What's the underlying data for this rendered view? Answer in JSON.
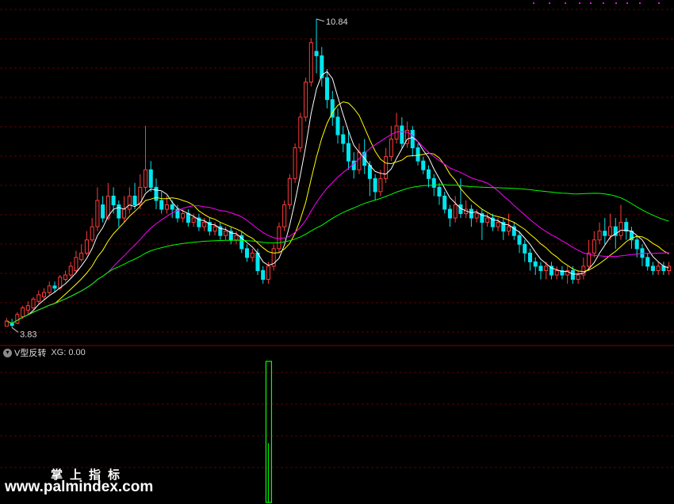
{
  "indicator": {
    "name": "V型反转",
    "xg_label": "XG:",
    "xg_value": "0.00"
  },
  "watermark": {
    "cn": "掌上指标",
    "url": "www.palmindex.com"
  },
  "colors": {
    "background": "#000000",
    "grid": "#5a0000",
    "separator": "#8b0000",
    "up": "#ff3b3b",
    "down": "#00e5ee",
    "ma5": "#ffffff",
    "ma10": "#ffff00",
    "ma20": "#ff00ff",
    "ma60": "#00ff00",
    "signal": "#00ff00",
    "marker": "#ff00ff"
  },
  "chart_data": [
    {
      "type": "candlestick",
      "panel": "main",
      "ylim": [
        3.5,
        11.2
      ],
      "annotations": {
        "high": "10.84",
        "low": "3.83"
      },
      "candles": [
        [
          3.83,
          3.95,
          3.9,
          4.02
        ],
        [
          3.9,
          3.85,
          3.8,
          4.0
        ],
        [
          3.9,
          4.1,
          3.88,
          4.15
        ],
        [
          4.05,
          4.25,
          4.0,
          4.3
        ],
        [
          4.2,
          4.3,
          4.1,
          4.4
        ],
        [
          4.25,
          4.45,
          4.2,
          4.5
        ],
        [
          4.4,
          4.55,
          4.35,
          4.65
        ],
        [
          4.5,
          4.6,
          4.45,
          4.7
        ],
        [
          4.6,
          4.75,
          4.55,
          4.85
        ],
        [
          4.75,
          4.7,
          4.6,
          4.85
        ],
        [
          4.7,
          4.95,
          4.65,
          5.0
        ],
        [
          4.9,
          5.0,
          4.85,
          5.1
        ],
        [
          5.0,
          5.2,
          4.95,
          5.3
        ],
        [
          5.1,
          5.4,
          5.05,
          5.55
        ],
        [
          5.35,
          5.5,
          5.3,
          5.7
        ],
        [
          5.5,
          5.8,
          5.45,
          6.0
        ],
        [
          5.8,
          6.1,
          5.75,
          6.3
        ],
        [
          6.1,
          6.7,
          6.0,
          7.0
        ],
        [
          6.6,
          6.3,
          6.2,
          6.8
        ],
        [
          6.3,
          6.8,
          6.25,
          7.1
        ],
        [
          6.8,
          6.6,
          6.4,
          7.0
        ],
        [
          6.6,
          6.3,
          6.1,
          6.7
        ],
        [
          6.3,
          6.5,
          6.2,
          6.8
        ],
        [
          6.5,
          6.8,
          6.4,
          7.0
        ],
        [
          6.8,
          6.6,
          6.5,
          7.1
        ],
        [
          6.6,
          7.0,
          6.5,
          7.3
        ],
        [
          7.0,
          7.4,
          6.9,
          8.4
        ],
        [
          7.4,
          7.0,
          6.9,
          7.6
        ],
        [
          7.0,
          6.7,
          6.5,
          7.2
        ],
        [
          6.7,
          6.5,
          6.4,
          6.9
        ],
        [
          6.5,
          6.6,
          6.4,
          6.8
        ],
        [
          6.6,
          6.5,
          6.3,
          6.7
        ],
        [
          6.5,
          6.3,
          6.2,
          6.6
        ],
        [
          6.3,
          6.4,
          6.2,
          6.5
        ],
        [
          6.4,
          6.2,
          6.1,
          6.5
        ],
        [
          6.2,
          6.3,
          6.1,
          6.4
        ],
        [
          6.3,
          6.1,
          6.0,
          6.4
        ],
        [
          6.1,
          6.2,
          6.0,
          6.3
        ],
        [
          6.2,
          6.0,
          5.9,
          6.3
        ],
        [
          6.0,
          6.1,
          5.9,
          6.2
        ],
        [
          6.1,
          5.9,
          5.8,
          6.2
        ],
        [
          5.9,
          6.0,
          5.8,
          6.1
        ],
        [
          6.0,
          5.8,
          5.7,
          6.1
        ],
        [
          5.8,
          5.9,
          5.7,
          6.0
        ],
        [
          5.9,
          5.6,
          5.5,
          6.0
        ],
        [
          5.6,
          5.4,
          5.3,
          5.7
        ],
        [
          5.4,
          5.5,
          5.3,
          5.6
        ],
        [
          5.5,
          5.1,
          5.0,
          5.6
        ],
        [
          5.1,
          4.9,
          4.8,
          5.2
        ],
        [
          4.9,
          5.2,
          4.8,
          5.3
        ],
        [
          5.2,
          5.6,
          5.1,
          5.7
        ],
        [
          5.6,
          6.1,
          5.5,
          6.2
        ],
        [
          6.1,
          6.6,
          6.0,
          6.7
        ],
        [
          6.6,
          7.2,
          6.5,
          7.3
        ],
        [
          7.2,
          7.9,
          7.1,
          8.0
        ],
        [
          7.9,
          8.6,
          7.8,
          8.7
        ],
        [
          8.6,
          9.4,
          8.5,
          9.5
        ],
        [
          9.4,
          10.3,
          9.3,
          10.4
        ],
        [
          10.1,
          10.0,
          9.6,
          10.84
        ],
        [
          10.0,
          9.5,
          9.3,
          10.2
        ],
        [
          9.5,
          9.0,
          8.8,
          9.7
        ],
        [
          9.0,
          8.6,
          8.4,
          9.2
        ],
        [
          8.6,
          8.2,
          8.0,
          8.8
        ],
        [
          8.2,
          8.0,
          7.8,
          8.4
        ],
        [
          8.0,
          7.6,
          7.4,
          8.3
        ],
        [
          7.6,
          7.4,
          7.2,
          7.8
        ],
        [
          7.4,
          7.8,
          7.3,
          8.0
        ],
        [
          7.8,
          7.5,
          7.3,
          8.1
        ],
        [
          7.5,
          7.2,
          6.8,
          7.6
        ],
        [
          7.2,
          6.9,
          6.7,
          7.3
        ],
        [
          6.9,
          7.2,
          6.8,
          7.4
        ],
        [
          7.2,
          7.7,
          7.1,
          7.9
        ],
        [
          7.7,
          8.1,
          7.6,
          8.4
        ],
        [
          8.1,
          8.4,
          8.0,
          8.7
        ],
        [
          8.4,
          8.0,
          7.9,
          8.6
        ],
        [
          8.0,
          8.3,
          7.9,
          8.5
        ],
        [
          8.3,
          7.9,
          7.7,
          8.4
        ],
        [
          7.9,
          7.6,
          7.5,
          8.0
        ],
        [
          7.6,
          7.4,
          7.3,
          7.7
        ],
        [
          7.4,
          7.2,
          7.0,
          7.5
        ],
        [
          7.2,
          7.0,
          6.8,
          7.3
        ],
        [
          7.0,
          6.8,
          6.6,
          7.1
        ],
        [
          6.8,
          6.5,
          6.4,
          6.9
        ],
        [
          6.5,
          6.3,
          6.1,
          6.6
        ],
        [
          6.3,
          6.6,
          6.2,
          6.8
        ],
        [
          6.6,
          6.4,
          6.3,
          7.2
        ],
        [
          6.4,
          6.5,
          6.3,
          6.7
        ],
        [
          6.5,
          6.3,
          6.1,
          6.6
        ],
        [
          6.3,
          6.4,
          6.2,
          6.5
        ],
        [
          6.4,
          6.2,
          5.8,
          6.5
        ],
        [
          6.2,
          6.3,
          6.1,
          6.4
        ],
        [
          6.3,
          6.1,
          6.0,
          6.4
        ],
        [
          6.1,
          6.2,
          6.0,
          6.3
        ],
        [
          6.2,
          6.0,
          5.8,
          6.3
        ],
        [
          6.0,
          6.1,
          5.9,
          6.4
        ],
        [
          6.1,
          5.9,
          5.8,
          6.2
        ],
        [
          5.9,
          5.7,
          5.5,
          6.0
        ],
        [
          5.7,
          5.5,
          5.3,
          5.8
        ],
        [
          5.5,
          5.3,
          5.1,
          5.6
        ],
        [
          5.3,
          5.2,
          5.0,
          5.4
        ],
        [
          5.2,
          5.1,
          4.9,
          5.3
        ],
        [
          5.1,
          5.2,
          4.9,
          5.3
        ],
        [
          5.2,
          5.0,
          4.9,
          5.3
        ],
        [
          5.0,
          5.1,
          4.9,
          5.2
        ],
        [
          5.1,
          5.0,
          4.9,
          5.2
        ],
        [
          5.0,
          5.1,
          4.8,
          5.2
        ],
        [
          5.1,
          4.9,
          4.8,
          5.2
        ],
        [
          4.9,
          5.0,
          4.8,
          5.1
        ],
        [
          5.0,
          5.2,
          4.9,
          5.4
        ],
        [
          5.2,
          5.5,
          5.1,
          5.8
        ],
        [
          5.5,
          5.8,
          5.4,
          6.0
        ],
        [
          5.8,
          6.0,
          5.7,
          6.2
        ],
        [
          6.0,
          5.9,
          5.7,
          6.3
        ],
        [
          5.9,
          6.1,
          5.8,
          6.4
        ],
        [
          6.1,
          5.9,
          5.6,
          6.3
        ],
        [
          5.9,
          6.2,
          5.8,
          6.6
        ],
        [
          6.2,
          6.0,
          5.8,
          6.3
        ],
        [
          6.0,
          5.8,
          5.6,
          6.1
        ],
        [
          5.8,
          5.6,
          5.4,
          5.9
        ],
        [
          5.6,
          5.4,
          5.2,
          5.7
        ],
        [
          5.4,
          5.2,
          5.1,
          5.5
        ],
        [
          5.2,
          5.1,
          5.0,
          5.3
        ],
        [
          5.1,
          5.2,
          5.0,
          5.3
        ],
        [
          5.2,
          5.1,
          5.0,
          5.3
        ],
        [
          5.1,
          5.2,
          5.0,
          5.3
        ]
      ],
      "ma": [
        {
          "name": "MA5",
          "period": 5,
          "color": "#ffffff"
        },
        {
          "name": "MA10",
          "period": 10,
          "color": "#ffff00"
        },
        {
          "name": "MA20",
          "period": 20,
          "color": "#ff00ff"
        },
        {
          "name": "MA60",
          "period": 60,
          "color": "#00ff00"
        }
      ]
    },
    {
      "type": "bar",
      "panel": "indicator",
      "ylim": [
        0,
        1
      ],
      "signals": [
        {
          "index": 49,
          "value": 1
        }
      ]
    }
  ]
}
